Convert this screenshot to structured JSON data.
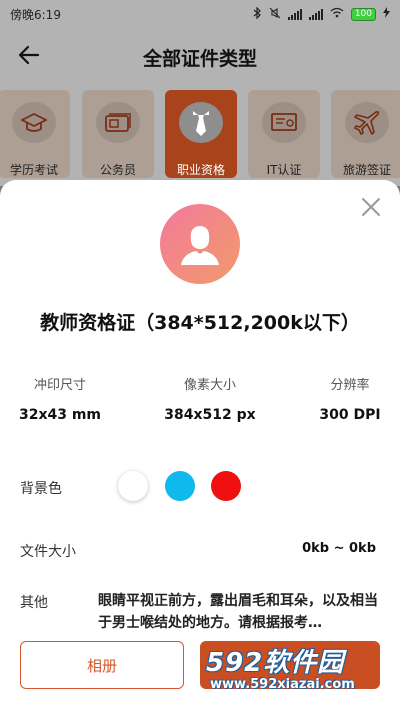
{
  "statusbar": {
    "time": "傍晚6:19",
    "battery": "100"
  },
  "nav": {
    "title": "全部证件类型"
  },
  "categories": [
    {
      "label": "学历考试",
      "icon": "graduation-cap-icon"
    },
    {
      "label": "公务员",
      "icon": "id-card-icon"
    },
    {
      "label": "职业资格",
      "icon": "necktie-icon",
      "active": true
    },
    {
      "label": "IT认证",
      "icon": "certificate-icon"
    },
    {
      "label": "旅游签证",
      "icon": "airplane-icon"
    }
  ],
  "sheet": {
    "title": "教师资格证（384*512,200k以下）",
    "specs": [
      {
        "label": "冲印尺寸",
        "value": "32x43 mm"
      },
      {
        "label": "像素大小",
        "value": "384x512 px"
      },
      {
        "label": "分辨率",
        "value": "300 DPI"
      }
    ],
    "background_label": "背景色",
    "background_colors": [
      "#ffffff",
      "#0fb9ee",
      "#f01010"
    ],
    "file_size_label": "文件大小",
    "file_size_value": "0kb ~ 0kb",
    "other_label": "其他",
    "other_text": "眼睛平视正前方，露出眉毛和耳朵，以及相当于男士喉结处的地方。请根据报考…",
    "album_button": "相册"
  },
  "watermark": {
    "line1": "592软件园",
    "line2": "www.592xiazai.com"
  },
  "colors": {
    "accent": "#d4582a",
    "active_tab": "#a8431c"
  }
}
